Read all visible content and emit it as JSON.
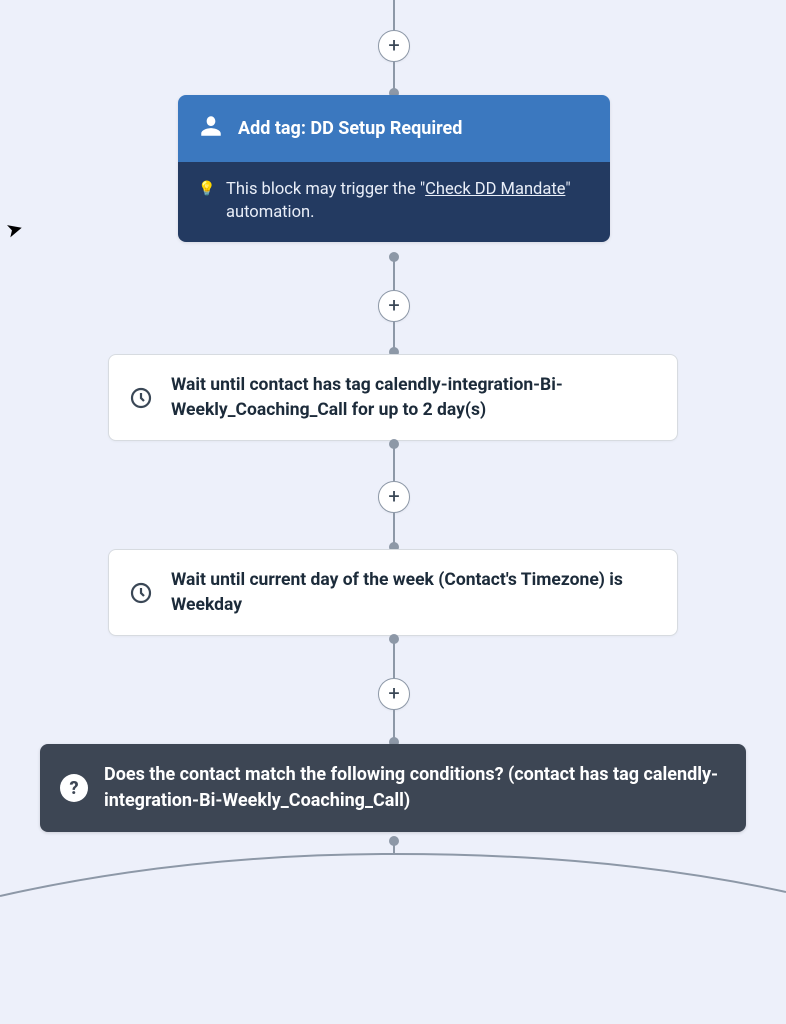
{
  "colors": {
    "bg": "#edf0fa",
    "primary_blue": "#3b78bf",
    "primary_dark": "#233a61",
    "connector": "#8d98a7",
    "card_border": "#d7dbe0",
    "condition_bg": "#3d4654"
  },
  "nodes": {
    "add_tag": {
      "icon": "person-icon",
      "title": "Add tag: DD Setup Required",
      "hint_prefix": "This block may trigger the \"",
      "hint_link": "Check DD Mandate",
      "hint_suffix": "\" automation."
    },
    "wait1": {
      "icon": "clock-icon",
      "text": "Wait until contact has tag calendly-integration-Bi-Weekly_Coaching_Call for up to 2 day(s)"
    },
    "wait2": {
      "icon": "clock-icon",
      "text": "Wait until current day of the week (Contact's Timezone) is Weekday"
    },
    "condition": {
      "icon": "question-icon",
      "text": "Does the contact match the following conditions? (contact has tag calendly-integration-Bi-Weekly_Coaching_Call)"
    }
  },
  "add_button_glyph": "+"
}
